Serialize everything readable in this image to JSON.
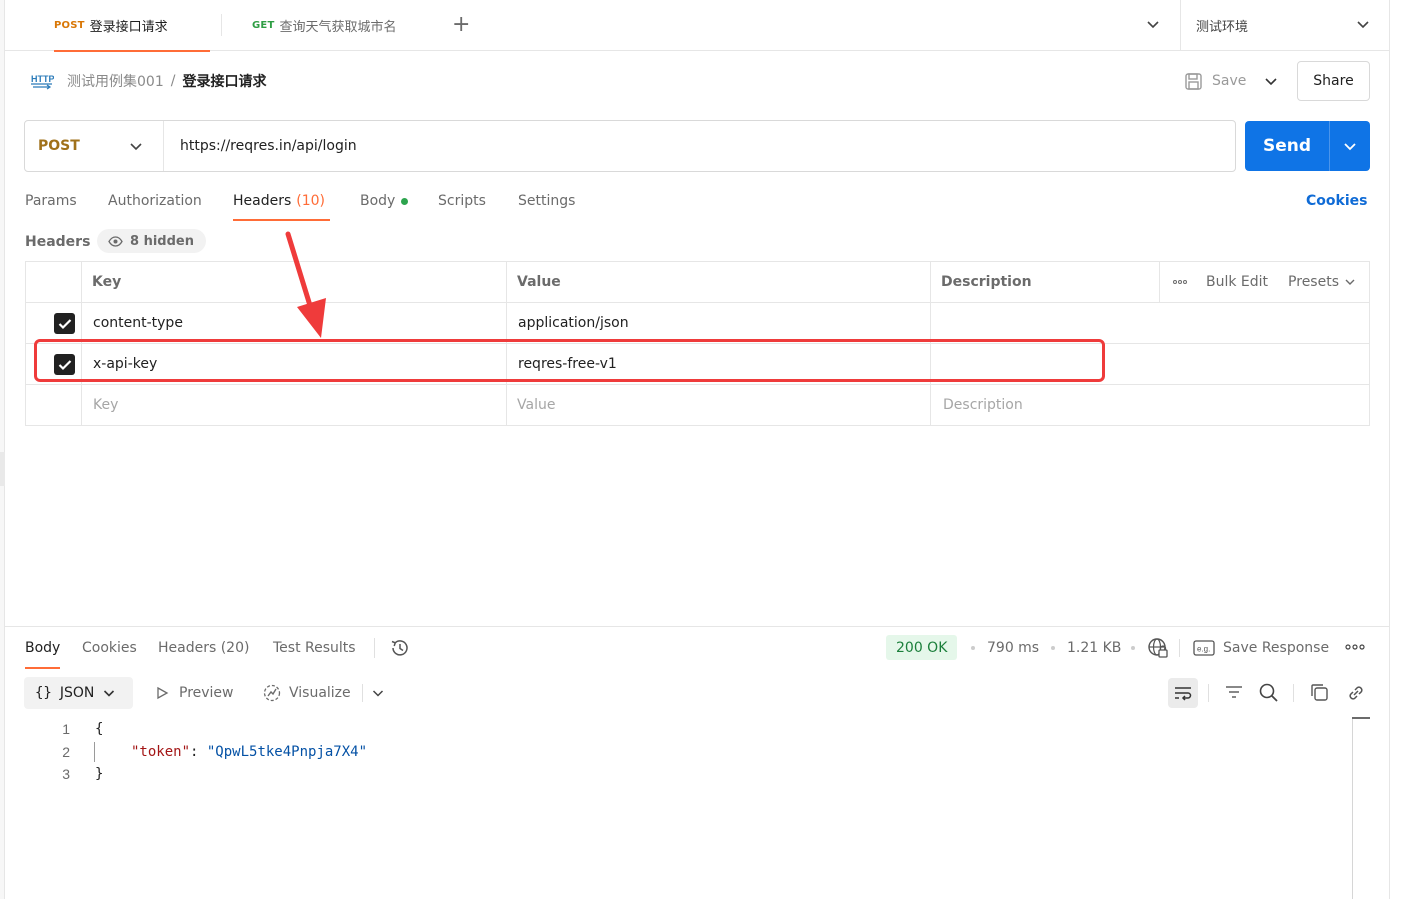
{
  "tabs": [
    {
      "method": "POST",
      "method_color": "#d97706",
      "title": "登录接口请求",
      "active": true
    },
    {
      "method": "GET",
      "method_color": "#2f9e44",
      "title": "查询天气获取城市名",
      "active": false
    }
  ],
  "environment": {
    "selected": "测试环境"
  },
  "breadcrumb": {
    "collection": "测试用例集001",
    "separator": "/",
    "request": "登录接口请求"
  },
  "toolbar": {
    "save_label": "Save",
    "share_label": "Share"
  },
  "request": {
    "method": "POST",
    "url": "https://reqres.in/api/login",
    "send_label": "Send"
  },
  "request_tabs": {
    "params": "Params",
    "authorization": "Authorization",
    "headers": "Headers",
    "headers_count": "(10)",
    "body": "Body",
    "scripts": "Scripts",
    "settings": "Settings",
    "cookies": "Cookies"
  },
  "headers_section": {
    "title": "Headers",
    "hidden_label": "8 hidden"
  },
  "headers_table": {
    "columns": {
      "key": "Key",
      "value": "Value",
      "description": "Description"
    },
    "bulk_edit": "Bulk Edit",
    "presets": "Presets",
    "rows": [
      {
        "checked": true,
        "key": "content-type",
        "value": "application/json",
        "description": ""
      },
      {
        "checked": true,
        "key": "x-api-key",
        "value": "reqres-free-v1",
        "description": ""
      }
    ],
    "placeholder": {
      "key": "Key",
      "value": "Value",
      "description": "Description"
    }
  },
  "annotation": {
    "color": "#ef3b3b"
  },
  "response": {
    "tabs": {
      "body": "Body",
      "cookies": "Cookies",
      "headers": "Headers (20)",
      "test_results": "Test Results"
    },
    "status": "200 OK",
    "time": "790 ms",
    "size": "1.21 KB",
    "save_response": "Save Response",
    "format": "JSON",
    "preview": "Preview",
    "visualize": "Visualize",
    "code_lines": [
      {
        "num": "1",
        "text": "{"
      },
      {
        "num": "2",
        "key": "\"token\"",
        "colon": ": ",
        "value": "\"QpwL5tke4Pnpja7X4\""
      },
      {
        "num": "3",
        "text": "}"
      }
    ]
  },
  "colors": {
    "accent": "#ff6c37",
    "send_blue": "#0f74e6",
    "post_method": "#a0711a",
    "status_ok_bg": "#e5f7ea",
    "status_ok_text": "#1b7f3b"
  }
}
